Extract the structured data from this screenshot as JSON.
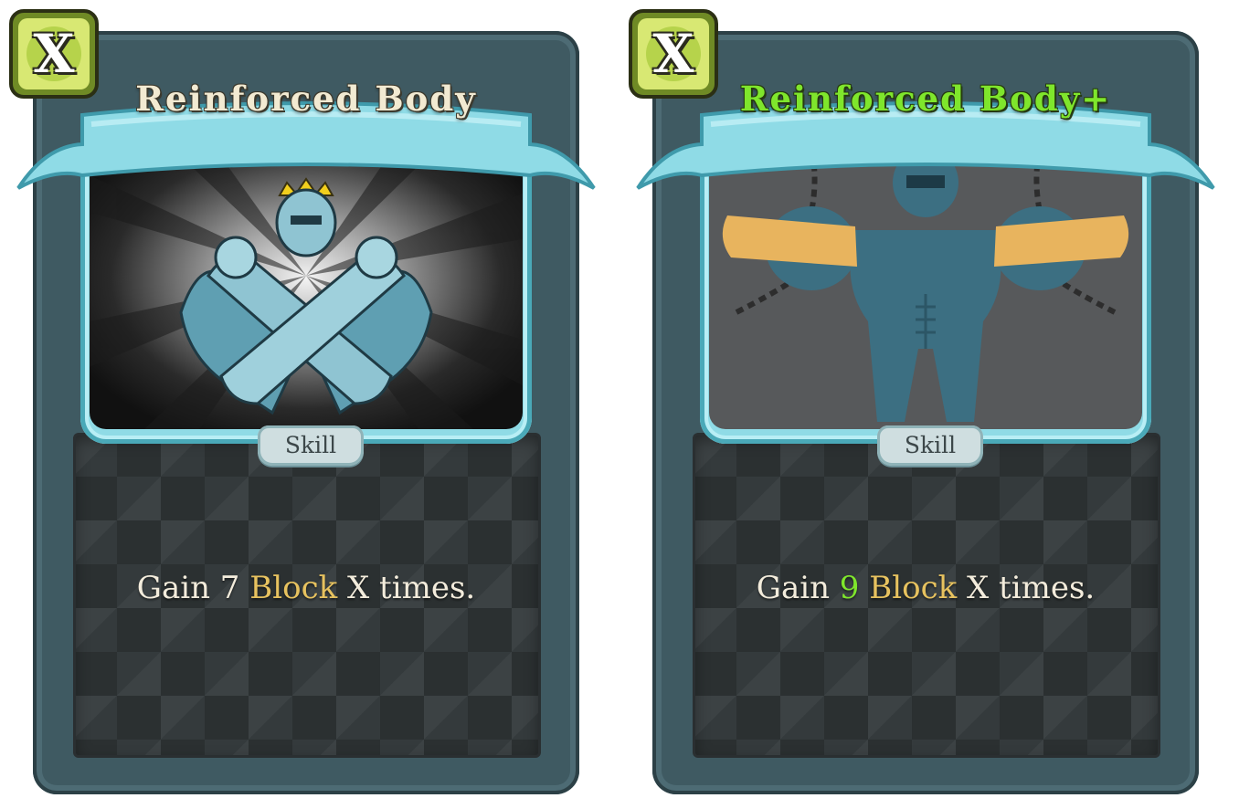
{
  "cards": [
    {
      "name": "Reinforced Body",
      "cost": "X",
      "type": "Skill",
      "description": {
        "prefix": "Gain ",
        "amount": "7",
        "keyword": "Block",
        "suffix": " X times."
      },
      "upgraded": false
    },
    {
      "name": "Reinforced Body+",
      "cost": "X",
      "type": "Skill",
      "description": {
        "prefix": "Gain ",
        "amount": "9",
        "keyword": "Block",
        "suffix": " X times."
      },
      "upgraded": true
    }
  ],
  "colors": {
    "frame": "#3f5a62",
    "banner": "#8fdbe6",
    "keyword": "#e7c25f",
    "upgrade": "#7fe62c",
    "energy": "#a7c53a"
  }
}
